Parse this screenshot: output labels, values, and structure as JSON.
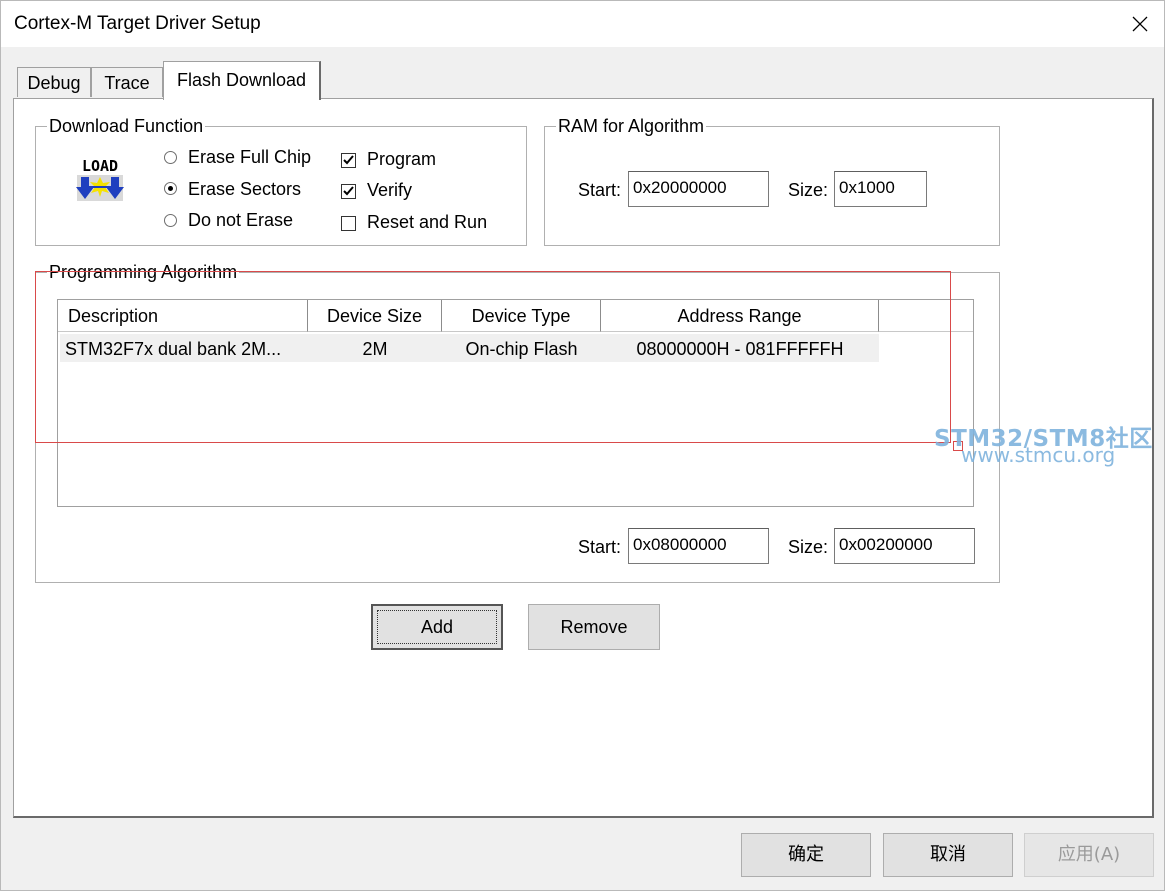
{
  "window": {
    "title": "Cortex-M Target Driver Setup"
  },
  "tabs": [
    {
      "label": "Debug",
      "active": false
    },
    {
      "label": "Trace",
      "active": false
    },
    {
      "label": "Flash Download",
      "active": true
    }
  ],
  "download_function": {
    "legend": "Download Function",
    "icon_text": "LOAD",
    "radios": [
      {
        "label": "Erase Full Chip",
        "checked": false
      },
      {
        "label": "Erase Sectors",
        "checked": true
      },
      {
        "label": "Do not Erase",
        "checked": false
      }
    ],
    "checkboxes": [
      {
        "label": "Program",
        "checked": true
      },
      {
        "label": "Verify",
        "checked": true
      },
      {
        "label": "Reset and Run",
        "checked": false
      }
    ]
  },
  "ram_for_algorithm": {
    "legend": "RAM for Algorithm",
    "start_label": "Start:",
    "start_value": "0x20000000",
    "size_label": "Size:",
    "size_value": "0x1000"
  },
  "programming_algorithm": {
    "legend": "Programming Algorithm",
    "columns": [
      "Description",
      "Device Size",
      "Device Type",
      "Address Range"
    ],
    "rows": [
      {
        "description": "STM32F7x dual bank 2M...",
        "device_size": "2M",
        "device_type": "On-chip Flash",
        "address_range": "08000000H - 081FFFFFH"
      }
    ],
    "start_label": "Start:",
    "start_value": "0x08000000",
    "size_label": "Size:",
    "size_value": "0x00200000"
  },
  "buttons": {
    "add": "Add",
    "remove": "Remove"
  },
  "dialog_buttons": {
    "ok": "确定",
    "cancel": "取消",
    "apply": "应用(A)"
  },
  "watermark": {
    "line1": "STM32/STM8社区",
    "line2": "www.stmcu.org"
  },
  "colors": {
    "window_bg": "#f0f0f0",
    "panel_bg": "#ffffff",
    "annotation_red": "#d94a4a",
    "watermark_blue": "#7fb3dd"
  }
}
